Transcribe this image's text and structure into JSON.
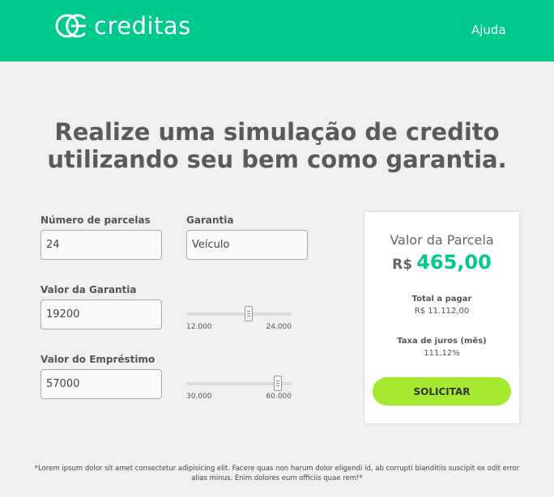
{
  "header": {
    "logo_text": "creditas",
    "help_label": "Ajuda",
    "colors": {
      "brand": "#00c98d",
      "button": "#a4e82f"
    }
  },
  "headline": {
    "line1": "Realize uma simulação de credito",
    "line2": "utilizando seu bem como garantia."
  },
  "form": {
    "installments": {
      "label": "Número de parcelas",
      "value": "24"
    },
    "collateral": {
      "label": "Garantia",
      "value": "Veículo"
    },
    "collateral_value": {
      "label": "Valor da Garantia",
      "value": "19200",
      "slider_min": "12.000",
      "slider_max": "24.000",
      "slider_level": 0.6
    },
    "loan_value": {
      "label": "Valor do Empréstimo",
      "value": "57000",
      "slider_min": "30.000",
      "slider_max": "60.000",
      "slider_level": 0.9
    }
  },
  "summary": {
    "title": "Valor da Parcela",
    "currency": "R$",
    "installment_value": "465,00",
    "total_label": "Total a pagar",
    "total_value": "R$ 11.112,00",
    "rate_label": "Taxa de juros (mês)",
    "rate_value": "111,12%",
    "cta_label": "SOLICITAR"
  },
  "footnote": "*Lorem ipsum dolor sit amet consectetur adipisicing elit. Facere quas non harum dolor eligendi id, ab corrupti blanditiis suscipit ex odit error alias minus. Enim dolores eum officiis quae rem!*"
}
